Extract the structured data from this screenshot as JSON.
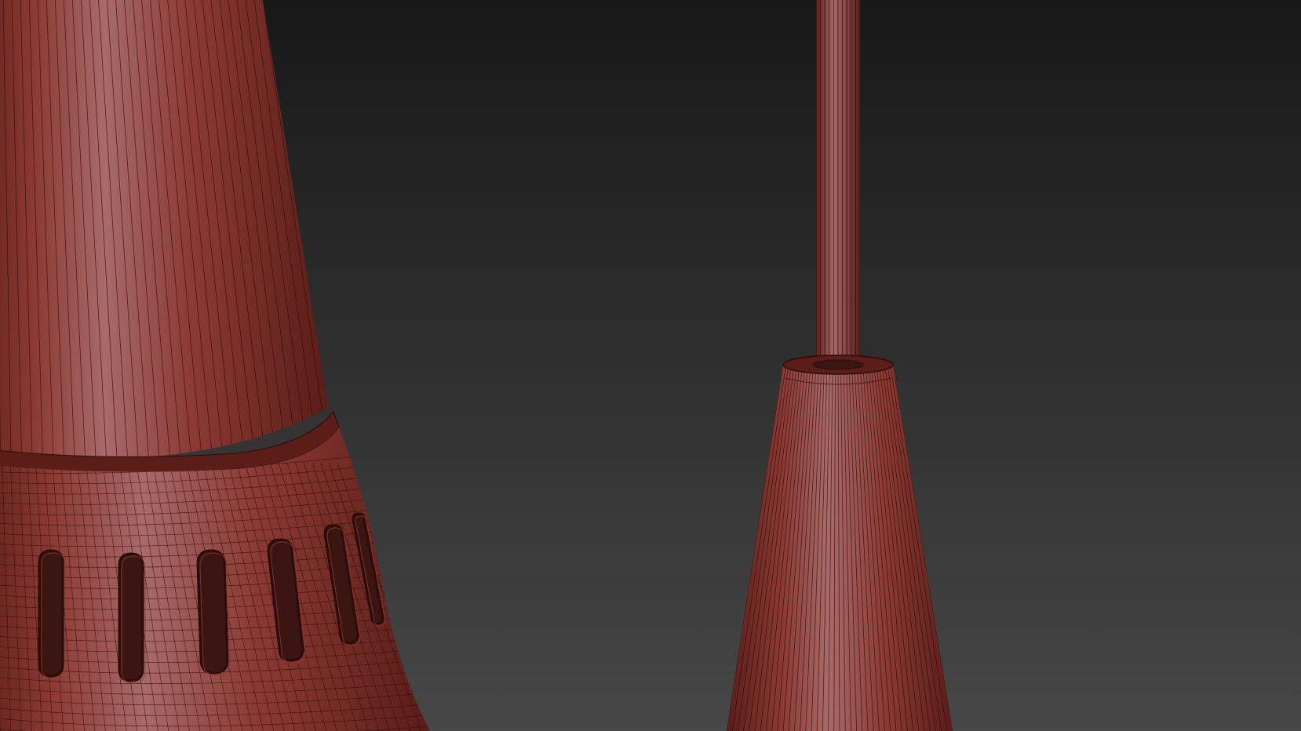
{
  "scene": {
    "background_top": "#181818",
    "background_bottom": "#474747",
    "model_color": "#8c3a33",
    "model_highlight": "#a86a6a",
    "model_shadow": "#5a1d18",
    "wire_color": "#2a0c08",
    "hole_color": "#3a1512"
  }
}
